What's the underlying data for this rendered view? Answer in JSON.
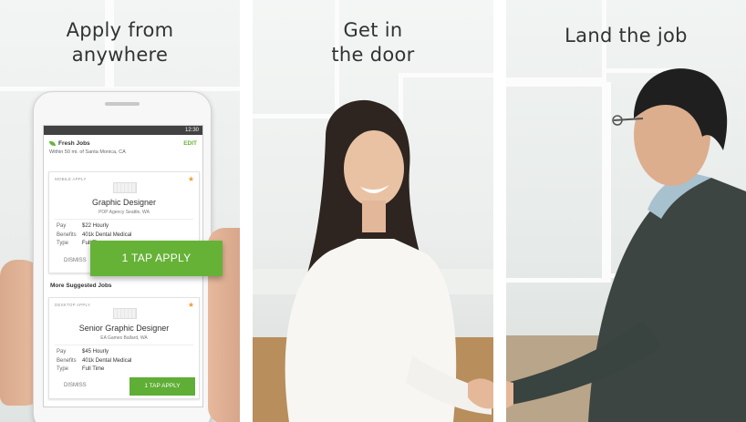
{
  "colors": {
    "accent_green": "#66b237",
    "star": "#f0a030"
  },
  "panels": [
    {
      "headline_lines": [
        "Apply from",
        "anywhere"
      ]
    },
    {
      "headline_lines": [
        "Get in",
        "the door"
      ]
    },
    {
      "headline_lines": [
        "Land the job"
      ]
    }
  ],
  "phone": {
    "status_time": "12:30",
    "header": {
      "title": "Fresh Jobs",
      "edit": "EDIT",
      "subtitle": "Within 50 mi. of Santa Monica, CA"
    },
    "card1": {
      "tag": "MOBILE APPLY",
      "job_title": "Graphic Designer",
      "company": "POP Agency Seattle, WA",
      "details": [
        {
          "k": "Pay",
          "v": "$22 Hourly"
        },
        {
          "k": "Benefits",
          "v": "401k Dental Medical"
        },
        {
          "k": "Type",
          "v": "Full Time"
        }
      ],
      "dismiss": "DISMISS"
    },
    "more_title": "More Suggested Jobs",
    "card2": {
      "tag": "DESKTOP APPLY",
      "job_title": "Senior Graphic Designer",
      "company": "EA Games Ballard, WA",
      "details": [
        {
          "k": "Pay",
          "v": "$45 Hourly"
        },
        {
          "k": "Benefits",
          "v": "401k Dental Medical"
        },
        {
          "k": "Type",
          "v": "Full Time"
        }
      ],
      "dismiss": "DISMISS",
      "apply": "1 TAP APPLY"
    },
    "big_apply": "1 TAP APPLY"
  }
}
